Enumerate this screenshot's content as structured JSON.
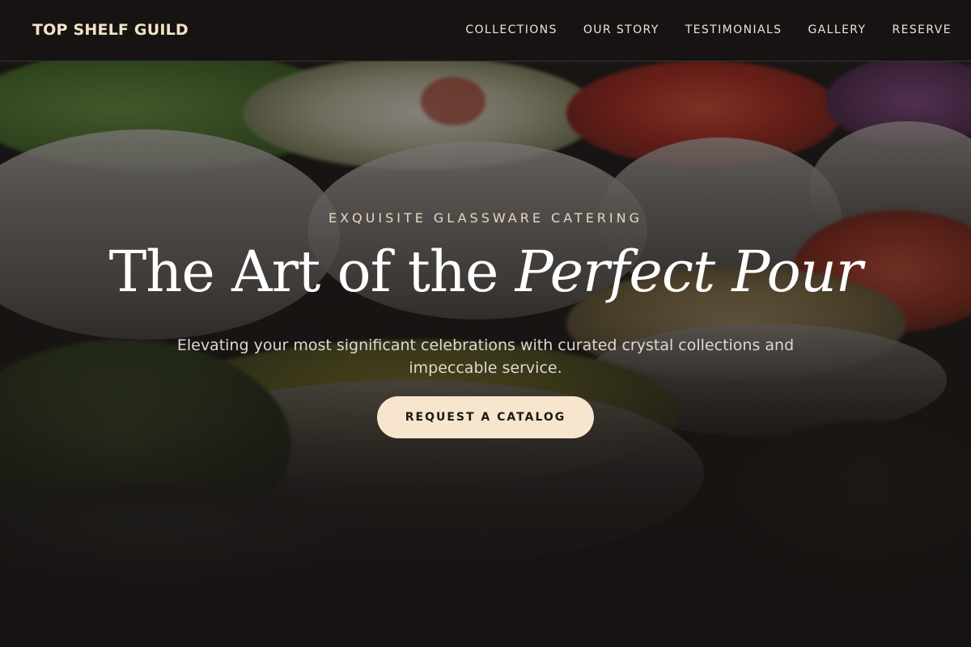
{
  "brand": {
    "name": "TOP SHELF GUILD"
  },
  "nav": {
    "links": [
      "COLLECTIONS",
      "OUR STORY",
      "TESTIMONIALS",
      "GALLERY",
      "RESERVE"
    ]
  },
  "hero": {
    "eyebrow": "EXQUISITE GLASSWARE CATERING",
    "headline_plain": "The Art of the ",
    "headline_italic": "Perfect Pour",
    "subtitle": "Elevating your most significant celebrations with curated crystal collections and impeccable service.",
    "cta_label": "REQUEST A CATALOG"
  },
  "colors": {
    "accent": "#f7e6cd",
    "brand": "#f3e3c6",
    "background": "#1c1816"
  }
}
